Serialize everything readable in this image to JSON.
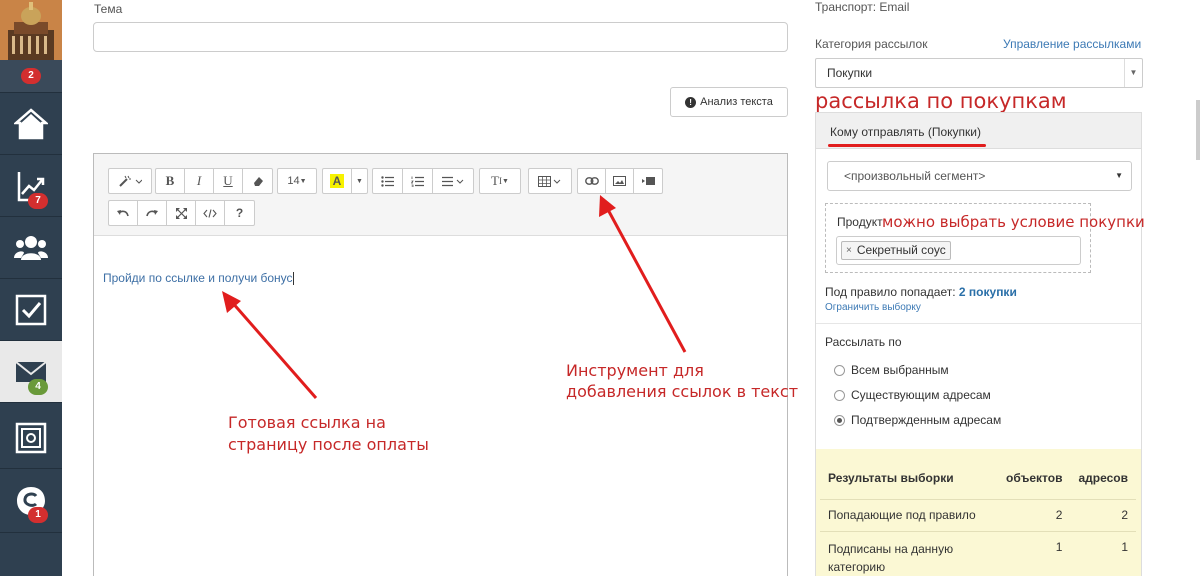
{
  "sidebar": {
    "badges": {
      "top": "2",
      "stats": "7",
      "mail": "4",
      "support": "1"
    }
  },
  "main": {
    "subject_label": "Тема",
    "subject_value": "",
    "analysis_button": "Анализ текста",
    "toolbar": {
      "font_size": "14",
      "text_style": "T",
      "help": "?"
    },
    "editor_text": "Пройди по ссылке и получи бонус"
  },
  "annotations": {
    "tool_note_line1": "Инструмент для",
    "tool_note_line2": "добавления ссылок в текст",
    "link_note_line1": "Готовая ссылка на",
    "link_note_line2": "страницу после оплаты",
    "purchase_note": "рассылка по покупкам",
    "condition_note": "можно выбрать условие покупки"
  },
  "right": {
    "transport": "Транспорт: Email",
    "category_label": "Категория рассылок",
    "manage_link": "Управление рассылками",
    "category_value": "Покупки",
    "panel_title": "Кому отправлять (Покупки)",
    "segment_value": "<произвольный сегмент>",
    "product_label": "Продукт",
    "product_tag": "Секретный соус",
    "rule_prefix": "Под правило попадает:",
    "rule_count": "2 покупки",
    "limit_link": "Ограничить выборку",
    "send_by_label": "Рассылать по",
    "radios": [
      "Всем выбранным",
      "Существующим адресам",
      "Подтвержденным адресам"
    ],
    "results": {
      "headers": [
        "Результаты выборки",
        "объектов",
        "адресов"
      ],
      "rows": [
        {
          "label": "Попадающие под правило",
          "objects": "2",
          "addresses": "2"
        },
        {
          "label": "Подписаны на данную категорию",
          "objects": "1",
          "addresses": "1"
        }
      ]
    }
  },
  "colors": {
    "sidebar": "#2f4050",
    "annotation": "#c62828",
    "link": "#3d7ab5",
    "results_bg": "#fbf8d4"
  }
}
